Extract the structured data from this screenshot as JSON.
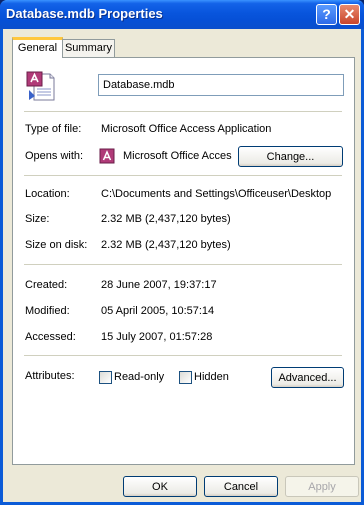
{
  "window": {
    "title": "Database.mdb Properties",
    "help_label": "?",
    "close_label": "✕"
  },
  "tabs": [
    {
      "label": "General",
      "active": true
    },
    {
      "label": "Summary",
      "active": false
    }
  ],
  "general": {
    "file_name": "Database.mdb",
    "type_label": "Type of file:",
    "type_value": "Microsoft Office Access Application",
    "opens_label": "Opens with:",
    "opens_value": "Microsoft Office Acces",
    "change_button": "Change...",
    "location_label": "Location:",
    "location_value": "C:\\Documents and Settings\\Officeuser\\Desktop",
    "size_label": "Size:",
    "size_value": "2.32 MB (2,437,120 bytes)",
    "size_on_disk_label": "Size on disk:",
    "size_on_disk_value": "2.32 MB (2,437,120 bytes)",
    "created_label": "Created:",
    "created_value": "28 June 2007, 19:37:17",
    "modified_label": "Modified:",
    "modified_value": "05 April 2005, 10:57:14",
    "accessed_label": "Accessed:",
    "accessed_value": "15 July 2007, 01:57:28",
    "attributes_label": "Attributes:",
    "readonly_label": "Read-only",
    "readonly_checked": false,
    "hidden_label": "Hidden",
    "hidden_checked": false,
    "advanced_button": "Advanced..."
  },
  "footer": {
    "ok": "OK",
    "cancel": "Cancel",
    "apply": "Apply"
  },
  "icons": {
    "file": "access-database-file-icon",
    "app": "access-application-icon"
  },
  "colors": {
    "titlebar": "#0855DD",
    "face": "#ECE9D8",
    "tab_highlight": "#FFC73C"
  }
}
